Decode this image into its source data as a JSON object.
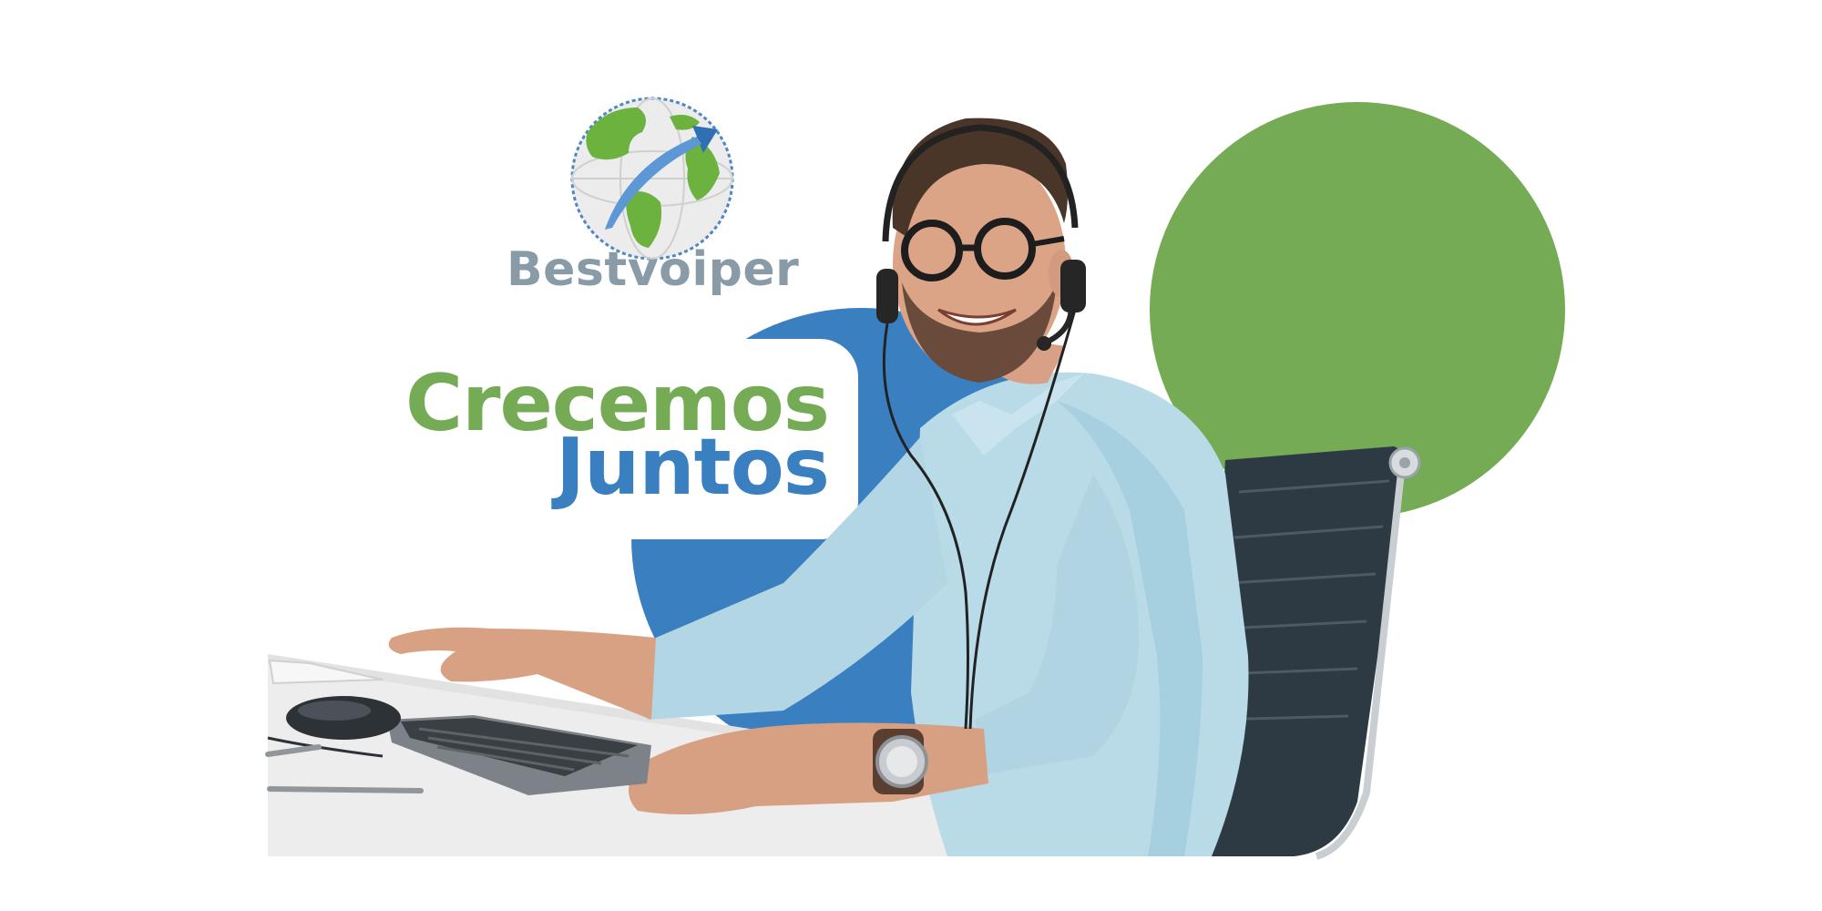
{
  "brand": {
    "name": "Bestvoiper"
  },
  "headline": {
    "line1": "Crecemos",
    "line2": "Juntos"
  },
  "colors": {
    "brand_gray": "#8a9ba8",
    "accent_green": "#74ab54",
    "accent_blue": "#3a7fc0",
    "shirt": "#b7d9e6",
    "skin": "#d9a184",
    "chair": "#2f3b44",
    "desk": "#eeeeee"
  },
  "icons": {
    "logo": "globe-arrow-icon"
  }
}
